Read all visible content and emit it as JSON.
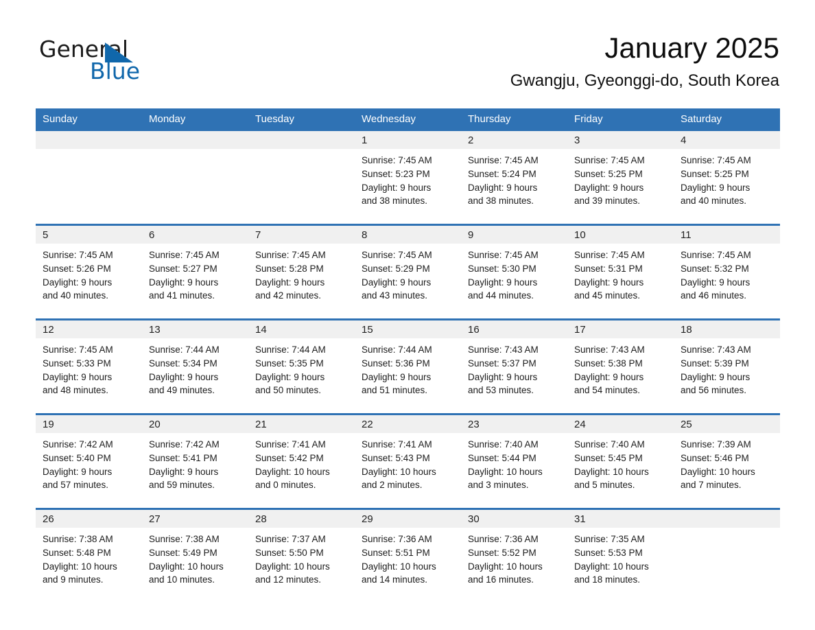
{
  "brand": {
    "word_one": "General",
    "word_two": "Blue",
    "triangle_icon": "triangle-icon",
    "accent_color": "#1067ab"
  },
  "header": {
    "month_title": "January 2025",
    "location": "Gwangju, Gyeonggi-do, South Korea"
  },
  "calendar": {
    "header_bg": "#2f72b4",
    "daynum_bg": "#f0f0f0",
    "weekday_headers": [
      "Sunday",
      "Monday",
      "Tuesday",
      "Wednesday",
      "Thursday",
      "Friday",
      "Saturday"
    ],
    "weeks": [
      [
        {
          "day": "",
          "sunrise": "",
          "sunset": "",
          "daylight_1": "",
          "daylight_2": ""
        },
        {
          "day": "",
          "sunrise": "",
          "sunset": "",
          "daylight_1": "",
          "daylight_2": ""
        },
        {
          "day": "",
          "sunrise": "",
          "sunset": "",
          "daylight_1": "",
          "daylight_2": ""
        },
        {
          "day": "1",
          "sunrise": "Sunrise: 7:45 AM",
          "sunset": "Sunset: 5:23 PM",
          "daylight_1": "Daylight: 9 hours",
          "daylight_2": "and 38 minutes."
        },
        {
          "day": "2",
          "sunrise": "Sunrise: 7:45 AM",
          "sunset": "Sunset: 5:24 PM",
          "daylight_1": "Daylight: 9 hours",
          "daylight_2": "and 38 minutes."
        },
        {
          "day": "3",
          "sunrise": "Sunrise: 7:45 AM",
          "sunset": "Sunset: 5:25 PM",
          "daylight_1": "Daylight: 9 hours",
          "daylight_2": "and 39 minutes."
        },
        {
          "day": "4",
          "sunrise": "Sunrise: 7:45 AM",
          "sunset": "Sunset: 5:25 PM",
          "daylight_1": "Daylight: 9 hours",
          "daylight_2": "and 40 minutes."
        }
      ],
      [
        {
          "day": "5",
          "sunrise": "Sunrise: 7:45 AM",
          "sunset": "Sunset: 5:26 PM",
          "daylight_1": "Daylight: 9 hours",
          "daylight_2": "and 40 minutes."
        },
        {
          "day": "6",
          "sunrise": "Sunrise: 7:45 AM",
          "sunset": "Sunset: 5:27 PM",
          "daylight_1": "Daylight: 9 hours",
          "daylight_2": "and 41 minutes."
        },
        {
          "day": "7",
          "sunrise": "Sunrise: 7:45 AM",
          "sunset": "Sunset: 5:28 PM",
          "daylight_1": "Daylight: 9 hours",
          "daylight_2": "and 42 minutes."
        },
        {
          "day": "8",
          "sunrise": "Sunrise: 7:45 AM",
          "sunset": "Sunset: 5:29 PM",
          "daylight_1": "Daylight: 9 hours",
          "daylight_2": "and 43 minutes."
        },
        {
          "day": "9",
          "sunrise": "Sunrise: 7:45 AM",
          "sunset": "Sunset: 5:30 PM",
          "daylight_1": "Daylight: 9 hours",
          "daylight_2": "and 44 minutes."
        },
        {
          "day": "10",
          "sunrise": "Sunrise: 7:45 AM",
          "sunset": "Sunset: 5:31 PM",
          "daylight_1": "Daylight: 9 hours",
          "daylight_2": "and 45 minutes."
        },
        {
          "day": "11",
          "sunrise": "Sunrise: 7:45 AM",
          "sunset": "Sunset: 5:32 PM",
          "daylight_1": "Daylight: 9 hours",
          "daylight_2": "and 46 minutes."
        }
      ],
      [
        {
          "day": "12",
          "sunrise": "Sunrise: 7:45 AM",
          "sunset": "Sunset: 5:33 PM",
          "daylight_1": "Daylight: 9 hours",
          "daylight_2": "and 48 minutes."
        },
        {
          "day": "13",
          "sunrise": "Sunrise: 7:44 AM",
          "sunset": "Sunset: 5:34 PM",
          "daylight_1": "Daylight: 9 hours",
          "daylight_2": "and 49 minutes."
        },
        {
          "day": "14",
          "sunrise": "Sunrise: 7:44 AM",
          "sunset": "Sunset: 5:35 PM",
          "daylight_1": "Daylight: 9 hours",
          "daylight_2": "and 50 minutes."
        },
        {
          "day": "15",
          "sunrise": "Sunrise: 7:44 AM",
          "sunset": "Sunset: 5:36 PM",
          "daylight_1": "Daylight: 9 hours",
          "daylight_2": "and 51 minutes."
        },
        {
          "day": "16",
          "sunrise": "Sunrise: 7:43 AM",
          "sunset": "Sunset: 5:37 PM",
          "daylight_1": "Daylight: 9 hours",
          "daylight_2": "and 53 minutes."
        },
        {
          "day": "17",
          "sunrise": "Sunrise: 7:43 AM",
          "sunset": "Sunset: 5:38 PM",
          "daylight_1": "Daylight: 9 hours",
          "daylight_2": "and 54 minutes."
        },
        {
          "day": "18",
          "sunrise": "Sunrise: 7:43 AM",
          "sunset": "Sunset: 5:39 PM",
          "daylight_1": "Daylight: 9 hours",
          "daylight_2": "and 56 minutes."
        }
      ],
      [
        {
          "day": "19",
          "sunrise": "Sunrise: 7:42 AM",
          "sunset": "Sunset: 5:40 PM",
          "daylight_1": "Daylight: 9 hours",
          "daylight_2": "and 57 minutes."
        },
        {
          "day": "20",
          "sunrise": "Sunrise: 7:42 AM",
          "sunset": "Sunset: 5:41 PM",
          "daylight_1": "Daylight: 9 hours",
          "daylight_2": "and 59 minutes."
        },
        {
          "day": "21",
          "sunrise": "Sunrise: 7:41 AM",
          "sunset": "Sunset: 5:42 PM",
          "daylight_1": "Daylight: 10 hours",
          "daylight_2": "and 0 minutes."
        },
        {
          "day": "22",
          "sunrise": "Sunrise: 7:41 AM",
          "sunset": "Sunset: 5:43 PM",
          "daylight_1": "Daylight: 10 hours",
          "daylight_2": "and 2 minutes."
        },
        {
          "day": "23",
          "sunrise": "Sunrise: 7:40 AM",
          "sunset": "Sunset: 5:44 PM",
          "daylight_1": "Daylight: 10 hours",
          "daylight_2": "and 3 minutes."
        },
        {
          "day": "24",
          "sunrise": "Sunrise: 7:40 AM",
          "sunset": "Sunset: 5:45 PM",
          "daylight_1": "Daylight: 10 hours",
          "daylight_2": "and 5 minutes."
        },
        {
          "day": "25",
          "sunrise": "Sunrise: 7:39 AM",
          "sunset": "Sunset: 5:46 PM",
          "daylight_1": "Daylight: 10 hours",
          "daylight_2": "and 7 minutes."
        }
      ],
      [
        {
          "day": "26",
          "sunrise": "Sunrise: 7:38 AM",
          "sunset": "Sunset: 5:48 PM",
          "daylight_1": "Daylight: 10 hours",
          "daylight_2": "and 9 minutes."
        },
        {
          "day": "27",
          "sunrise": "Sunrise: 7:38 AM",
          "sunset": "Sunset: 5:49 PM",
          "daylight_1": "Daylight: 10 hours",
          "daylight_2": "and 10 minutes."
        },
        {
          "day": "28",
          "sunrise": "Sunrise: 7:37 AM",
          "sunset": "Sunset: 5:50 PM",
          "daylight_1": "Daylight: 10 hours",
          "daylight_2": "and 12 minutes."
        },
        {
          "day": "29",
          "sunrise": "Sunrise: 7:36 AM",
          "sunset": "Sunset: 5:51 PM",
          "daylight_1": "Daylight: 10 hours",
          "daylight_2": "and 14 minutes."
        },
        {
          "day": "30",
          "sunrise": "Sunrise: 7:36 AM",
          "sunset": "Sunset: 5:52 PM",
          "daylight_1": "Daylight: 10 hours",
          "daylight_2": "and 16 minutes."
        },
        {
          "day": "31",
          "sunrise": "Sunrise: 7:35 AM",
          "sunset": "Sunset: 5:53 PM",
          "daylight_1": "Daylight: 10 hours",
          "daylight_2": "and 18 minutes."
        },
        {
          "day": "",
          "sunrise": "",
          "sunset": "",
          "daylight_1": "",
          "daylight_2": ""
        }
      ]
    ]
  }
}
